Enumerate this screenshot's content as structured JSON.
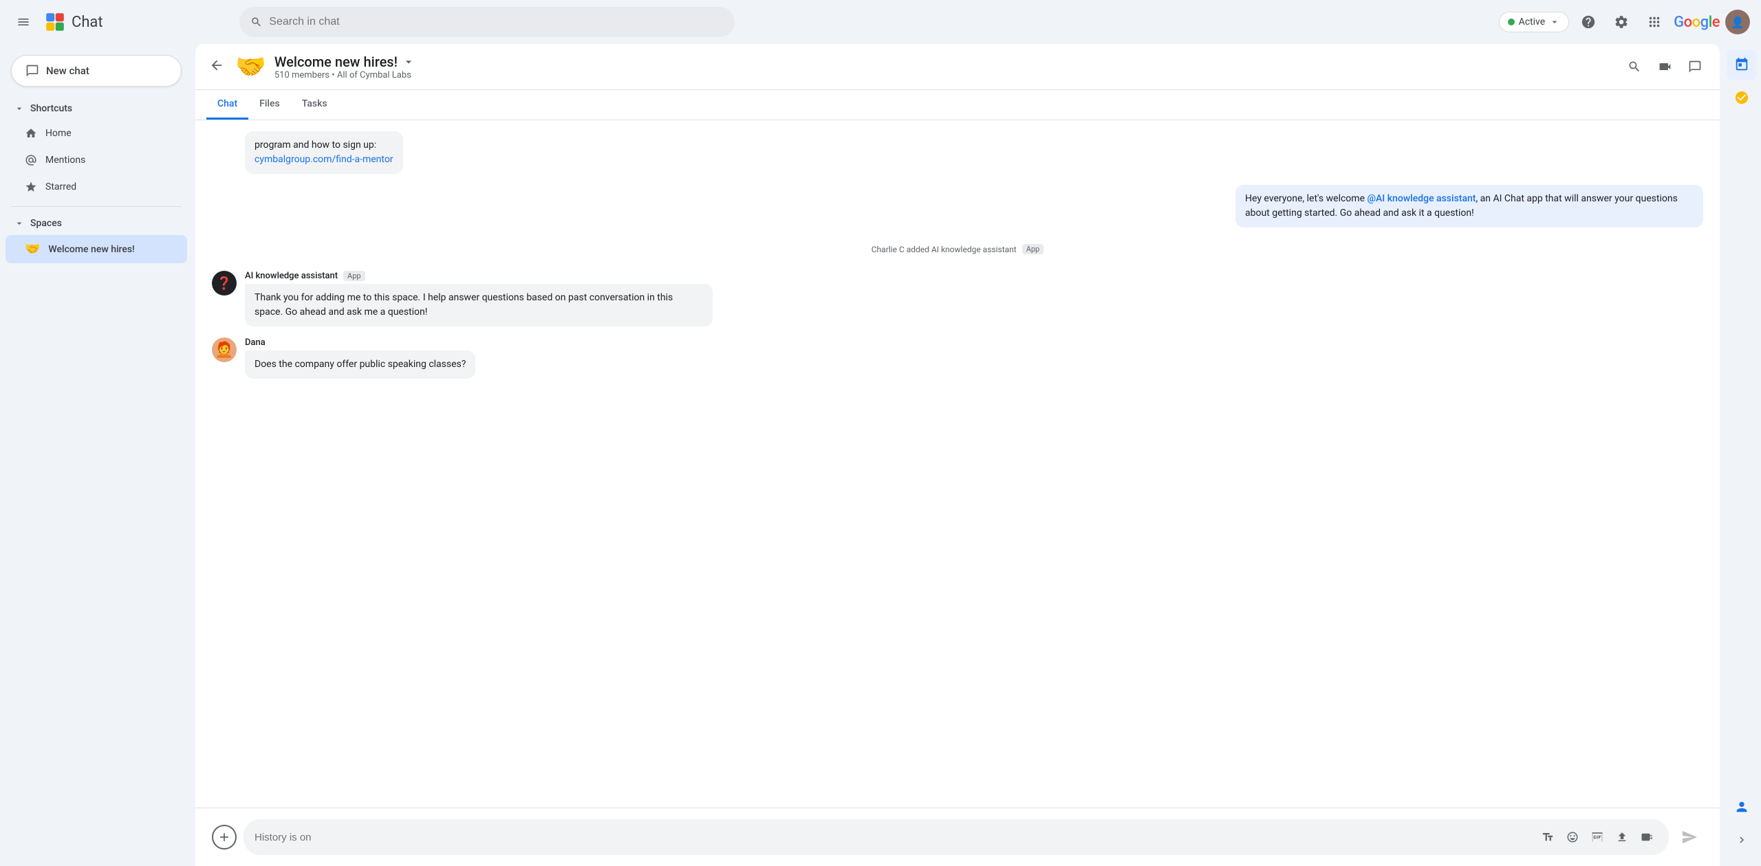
{
  "topbar": {
    "menu_label": "☰",
    "app_name": "Chat",
    "search_placeholder": "Search in chat",
    "active_label": "Active",
    "help_icon": "?",
    "settings_icon": "⚙",
    "grid_icon": "⋮⋮⋮",
    "google_label": "Google"
  },
  "sidebar": {
    "new_chat_label": "New chat",
    "shortcuts_label": "Shortcuts",
    "home_label": "Home",
    "mentions_label": "Mentions",
    "starred_label": "Starred",
    "spaces_label": "Spaces",
    "active_space": "Welcome new hires!"
  },
  "chat_header": {
    "space_name": "Welcome new hires!",
    "space_emoji": "🤝",
    "member_count": "510 members",
    "organization": "All of Cymbal Labs",
    "separator": "•"
  },
  "tabs": [
    {
      "label": "Chat",
      "active": true
    },
    {
      "label": "Files",
      "active": false
    },
    {
      "label": "Tasks",
      "active": false
    }
  ],
  "messages": [
    {
      "type": "incoming_partial",
      "text_line1": "program and how to sign up:",
      "link": "cymbalgroup.com/find-a-mentor"
    },
    {
      "type": "outgoing",
      "text": "Hey everyone, let's welcome @AI knowledge assistant, an AI Chat app that will answer your questions about getting started.  Go ahead and ask it a question!"
    },
    {
      "type": "system",
      "text": "Charlie C added AI knowledge assistant",
      "badge": "App"
    },
    {
      "type": "incoming",
      "sender": "AI knowledge assistant",
      "badge": "App",
      "avatar": "❓",
      "text": "Thank you for adding me to this space. I help answer questions based on past conversation in this space. Go ahead and ask me a question!"
    },
    {
      "type": "incoming",
      "sender": "Dana",
      "avatar_color": "#d4a373",
      "text": "Does the company offer public speaking classes?"
    }
  ],
  "input": {
    "placeholder": "History is on"
  },
  "right_sidebar": {
    "calendar_icon": "📅",
    "tasks_icon": "✓",
    "contacts_icon": "👤"
  }
}
